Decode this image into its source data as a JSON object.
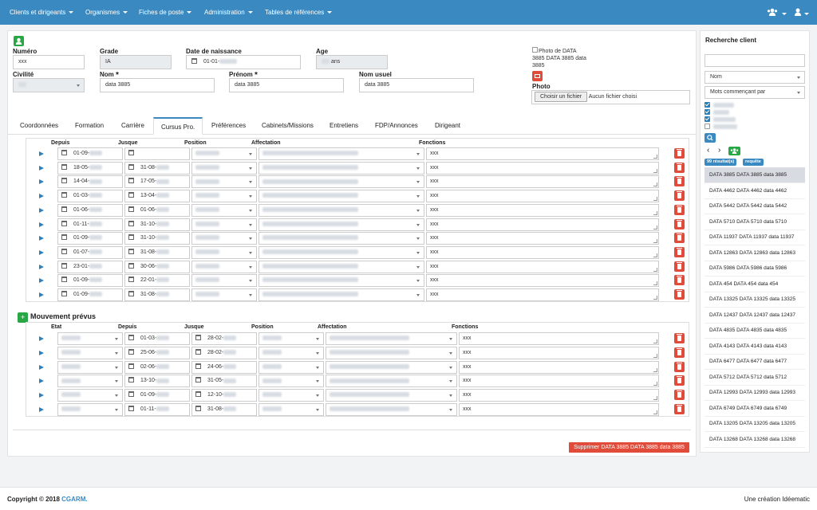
{
  "nav": {
    "items": [
      {
        "label": "Clients et dirigeants"
      },
      {
        "label": "Organismes"
      },
      {
        "label": "Fiches de poste"
      },
      {
        "label": "Administration"
      },
      {
        "label": "Tables de références"
      }
    ],
    "users_icon": "users-icon",
    "user_icon": "user-icon"
  },
  "form": {
    "numero": {
      "label": "Numéro",
      "value": "xxx"
    },
    "grade": {
      "label": "Grade",
      "value": "IA"
    },
    "date_naissance": {
      "label": "Date de naissance",
      "value": "01-01-"
    },
    "age": {
      "label": "Age",
      "value": "ans"
    },
    "civilite": {
      "label": "Civilité"
    },
    "nom": {
      "label": "Nom",
      "value": "data  3885",
      "required": "*"
    },
    "prenom": {
      "label": "Prénom",
      "value": "data  3885",
      "required": "*"
    },
    "nom_usuel": {
      "label": "Nom usuel",
      "value": "data  3885"
    },
    "photo": {
      "alt": "Photo de DATA 3885 DATA 3885 data 3885",
      "label": "Photo",
      "choose": "Choisir un fichier",
      "none": "Aucun fichier choisi"
    }
  },
  "tabs": [
    {
      "label": "Coordonnées"
    },
    {
      "label": "Formation"
    },
    {
      "label": "Carrière"
    },
    {
      "label": "Cursus Pro."
    },
    {
      "label": "Préférences"
    },
    {
      "label": "Cabinets/Missions"
    },
    {
      "label": "Entretiens"
    },
    {
      "label": "FDP/Annonces"
    },
    {
      "label": "Dirigeant"
    }
  ],
  "cursus": {
    "headers": [
      "Depuis",
      "Jusque",
      "Position",
      "Affectation",
      "Fonctions"
    ],
    "rows": [
      {
        "depuis": "01-09-",
        "jusque": "",
        "fonctions": "xxx"
      },
      {
        "depuis": "18-05-",
        "jusque": "31-08-",
        "fonctions": "xxx"
      },
      {
        "depuis": "14-04-",
        "jusque": "17-05-",
        "fonctions": "xxx"
      },
      {
        "depuis": "01-03-",
        "jusque": "13-04-",
        "fonctions": "xxx"
      },
      {
        "depuis": "01-06-",
        "jusque": "01-06-",
        "fonctions": "xxx"
      },
      {
        "depuis": "01-11-",
        "jusque": "31-10-",
        "fonctions": "xxx"
      },
      {
        "depuis": "01-09-",
        "jusque": "31-10-",
        "fonctions": "xxx"
      },
      {
        "depuis": "01-07-",
        "jusque": "31-08-",
        "fonctions": "xxx"
      },
      {
        "depuis": "23-01-",
        "jusque": "30-06-",
        "fonctions": "xxx"
      },
      {
        "depuis": "01-09-",
        "jusque": "22-01-",
        "fonctions": "xxx"
      },
      {
        "depuis": "01-09-",
        "jusque": "31-08-",
        "fonctions": "xxx"
      }
    ]
  },
  "mouvement": {
    "title": "Mouvement prévus",
    "headers": [
      "Etat",
      "Depuis",
      "Jusque",
      "Position",
      "Affectation",
      "Fonctions"
    ],
    "rows": [
      {
        "depuis": "01-03-",
        "jusque": "28-02-",
        "fonctions": "xxx"
      },
      {
        "depuis": "25-06-",
        "jusque": "28-02-",
        "fonctions": "xxx"
      },
      {
        "depuis": "02-06-",
        "jusque": "24-06-",
        "fonctions": "xxx"
      },
      {
        "depuis": "13-10-",
        "jusque": "31-05-",
        "fonctions": "xxx"
      },
      {
        "depuis": "01-09-",
        "jusque": "12-10-",
        "fonctions": "xxx"
      },
      {
        "depuis": "01-11-",
        "jusque": "31-08-",
        "fonctions": "xxx"
      }
    ]
  },
  "delete_label": "Supprimer DATA 3885 DATA 3885 data 3885",
  "sidebar": {
    "title": "Recherche client",
    "search_value": "",
    "field_select": "Nom",
    "mode_select": "Mots commençant par",
    "results_badge": "99 résultat(s)",
    "requete_badge": "requête",
    "results": [
      "DATA 3885 DATA 3885 data 3885",
      "DATA 4462 DATA 4462 data 4462",
      "DATA 5442 DATA 5442 data 5442",
      "DATA 5710 DATA 5710 data 5710",
      "DATA 11937 DATA 11937 data 11937",
      "DATA 12863 DATA 12863 data 12863",
      "DATA 5986 DATA 5986 data 5986",
      "DATA 454 DATA 454 data 454",
      "DATA 13325 DATA 13325 data 13325",
      "DATA 12437 DATA 12437 data 12437",
      "DATA 4835 DATA 4835 data 4835",
      "DATA 4143 DATA 4143 data 4143",
      "DATA 6477 DATA 6477 data 6477",
      "DATA 5712 DATA 5712 data 5712",
      "DATA 12993 DATA 12993 data 12993",
      "DATA 6749 DATA 6749 data 6749",
      "DATA 13205 DATA 13205 data 13205",
      "DATA 13268 DATA 13268 data 13268"
    ]
  },
  "footer": {
    "copyright": "Copyright © 2018 ",
    "brand": "CGARM.",
    "credit": "Une création Idéematic"
  },
  "colors": {
    "nav": "#3a8ac1",
    "danger": "#e04b3a",
    "success": "#28a745"
  }
}
